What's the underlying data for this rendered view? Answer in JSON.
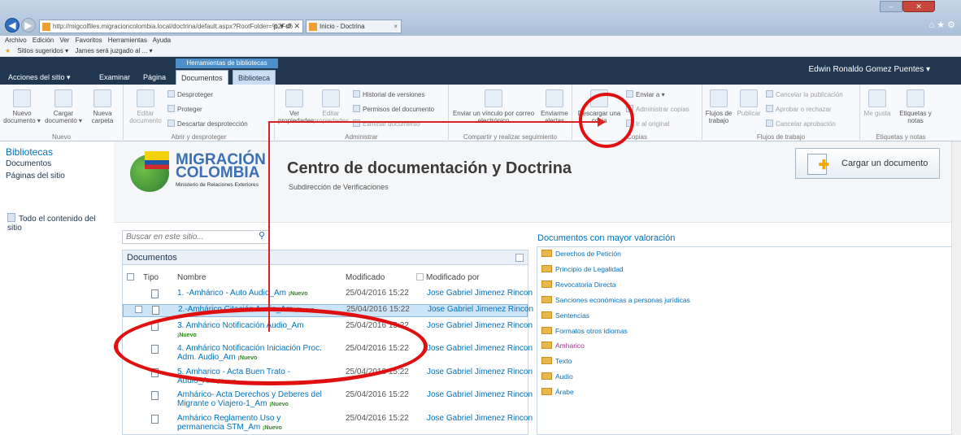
{
  "browser": {
    "address": "http://migcolfiles.migracioncolombia.local/doctrina/default.aspx?RootFolder=%2Fdo",
    "address_controls": "ρ ▾ ↺ ✕",
    "tab_title": "Inicio - Doctrina",
    "menu": [
      "Archivo",
      "Edición",
      "Ver",
      "Favoritos",
      "Herramientas",
      "Ayuda"
    ],
    "favorites": [
      "Sitios sugeridos ▾",
      "James será juzgado al ... ▾"
    ]
  },
  "ribbon": {
    "context_label": "Herramientas de bibliotecas",
    "user": "Edwin Ronaldo Gomez Puentes ▾",
    "tabs": [
      "Acciones del sitio ▾",
      "Examinar",
      "Página",
      "Documentos",
      "Biblioteca"
    ],
    "groups": {
      "nuevo": {
        "label": "Nuevo",
        "new_doc": "Nuevo documento ▾",
        "upload": "Cargar documento ▾",
        "new_folder": "Nueva carpeta"
      },
      "abrir": {
        "label": "Abrir y desproteger",
        "edit": "Editar documento",
        "checkout": "Desproteger",
        "checkin": "Proteger",
        "discard": "Descartar desprotección"
      },
      "administrar": {
        "label": "Administrar",
        "view": "Ver propiedades",
        "edit": "Editar propiedades",
        "history": "Historial de versiones",
        "perms": "Permisos del documento",
        "delete": "Eliminar documento"
      },
      "compartir": {
        "label": "Compartir y realizar seguimiento",
        "email": "Enviar un vínculo por correo electrónico",
        "alert": "Enviarme alertas"
      },
      "copias": {
        "label": "Copias",
        "download": "Descargar una copia",
        "send": "Enviar a ▾",
        "manage": "Administrar copias",
        "goto": "Ir al original"
      },
      "flujos": {
        "label": "Flujos de trabajo",
        "wf": "Flujos de trabajo",
        "publish": "Publicar",
        "cancel_pub": "Cancelar la publicación",
        "approve": "Aprobar o rechazar",
        "cancel_appr": "Cancelar aprobación"
      },
      "etiquetas": {
        "label": "Etiquetas y notas",
        "like": "Me gusta",
        "tags": "Etiquetas y notas"
      }
    }
  },
  "leftnav": {
    "heading": "Bibliotecas",
    "items": [
      "Documentos",
      "Páginas del sitio"
    ],
    "all_content": "Todo el contenido del sitio"
  },
  "header": {
    "logo_line1": "MIGRACIÓN",
    "logo_line2": "COLOMBIA",
    "logo_sub": "Ministerio de Relaciones Exteriores",
    "title": "Centro de documentación y Doctrina",
    "subtitle": "Subdirección de Verificaciones",
    "upload_button": "Cargar un documento"
  },
  "search": {
    "placeholder": "Buscar en este sitio..."
  },
  "documents": {
    "title": "Documentos",
    "columns": [
      "Tipo",
      "Nombre",
      "Modificado",
      "Modificado por"
    ],
    "new_badge": "Nuevo",
    "rows": [
      {
        "name": "1. -Amhárico - Auto Audio_Am",
        "modified": "25/04/2016 15:22",
        "by": "Jose Gabriel Jimenez Rincon"
      },
      {
        "name": "2.-Amhárico Citación Audio_Am",
        "modified": "25/04/2016 15:22",
        "by": "Jose Gabriel Jimenez Rincon"
      },
      {
        "name": "3. Amhárico Notificación Audio_Am",
        "modified": "25/04/2016 15:22",
        "by": "Jose Gabriel Jimenez Rincon"
      },
      {
        "name": "4. Amhárico Notificación Iniciación Proc. Adm. Audio_Am",
        "modified": "25/04/2016 15:22",
        "by": "Jose Gabriel Jimenez Rincon"
      },
      {
        "name": "5. Amharico - Acta Buen Trato - Audio_Am",
        "modified": "25/04/2016 15:22",
        "by": "Jose Gabriel Jimenez Rincon"
      },
      {
        "name": "Amhárico- Acta Derechos y Deberes del Migrante o Viajero-1_Am",
        "modified": "25/04/2016 15:22",
        "by": "Jose Gabriel Jimenez Rincon"
      },
      {
        "name": "Amhárico Reglamento Uso y permanencia STM_Am",
        "modified": "25/04/2016 15:22",
        "by": "Jose Gabriel Jimenez Rincon"
      }
    ]
  },
  "rated": {
    "title": "Documentos con mayor valoración",
    "folders": [
      "Derechos de Petición",
      "Principio de Legalidad",
      "Revocatoria Directa",
      "Sanciones económicas a personas jurídicas",
      "Sentencias",
      "Formatos otros idiomas",
      "Amharico",
      "Texto",
      "Audio",
      "Árabe"
    ]
  }
}
